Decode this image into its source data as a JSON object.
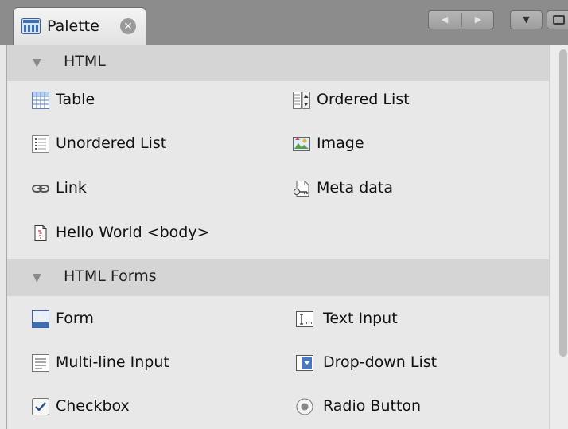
{
  "tab": {
    "title": "Palette",
    "close": "×"
  },
  "nav": {
    "prev": "◀",
    "next": "▶",
    "menu": "▼"
  },
  "categories": [
    {
      "label": "HTML",
      "arrow": "▼",
      "items": [
        {
          "label": "Table",
          "icon": "table-icon"
        },
        {
          "label": "Ordered List",
          "icon": "ordered-list-icon"
        },
        {
          "label": "Unordered List",
          "icon": "unordered-list-icon"
        },
        {
          "label": "Image",
          "icon": "image-icon"
        },
        {
          "label": "Link",
          "icon": "link-icon"
        },
        {
          "label": "Meta data",
          "icon": "meta-data-icon"
        },
        {
          "label": "Hello World <body>",
          "icon": "document-icon"
        }
      ]
    },
    {
      "label": "HTML Forms",
      "arrow": "▼",
      "items": [
        {
          "label": "Form",
          "icon": "form-icon"
        },
        {
          "label": "Text Input",
          "icon": "text-input-icon"
        },
        {
          "label": "Multi-line Input",
          "icon": "multi-line-input-icon"
        },
        {
          "label": "Drop-down List",
          "icon": "drop-down-list-icon"
        },
        {
          "label": "Checkbox",
          "icon": "checkbox-icon"
        },
        {
          "label": "Radio Button",
          "icon": "radio-button-icon"
        }
      ]
    }
  ]
}
